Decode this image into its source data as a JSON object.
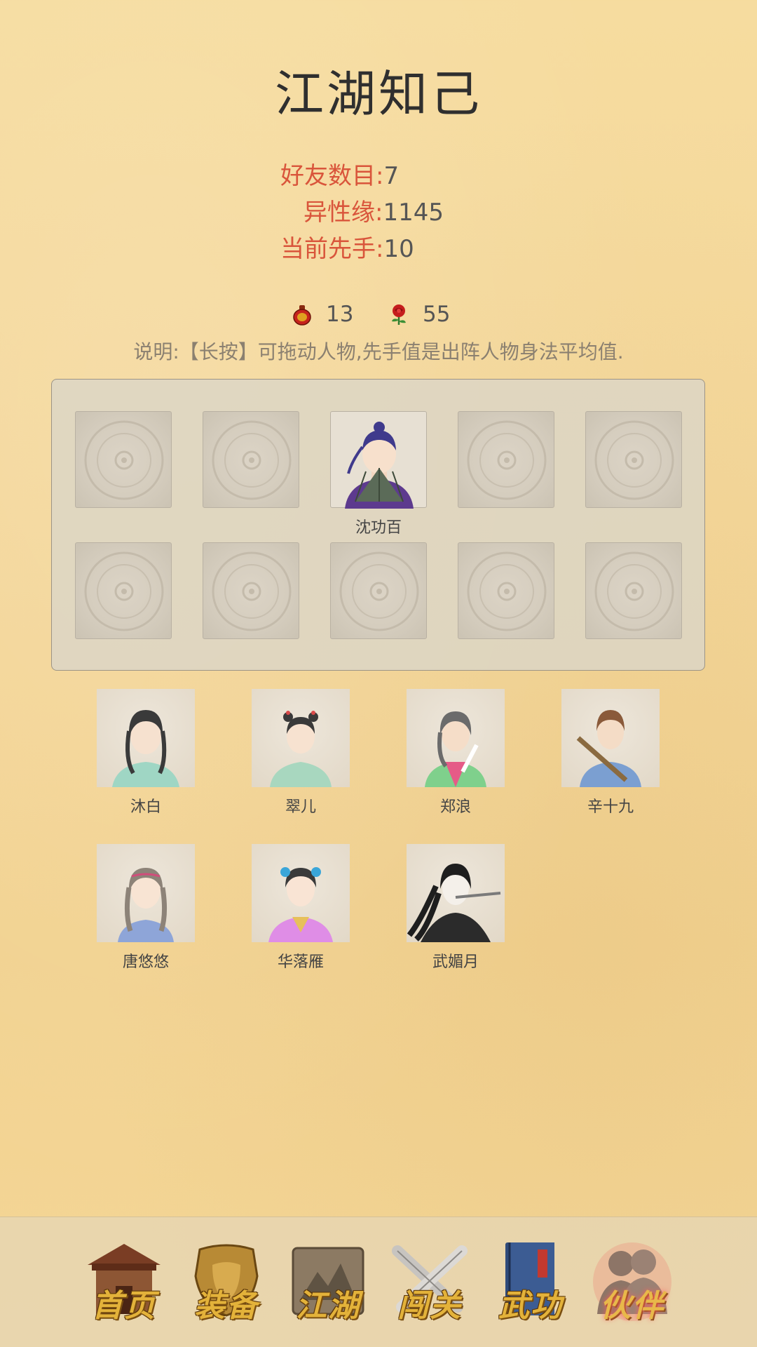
{
  "page": {
    "title": "江湖知己"
  },
  "stats": [
    {
      "label": "好友数目:",
      "value": "7"
    },
    {
      "label": "异性缘:",
      "value": "1145"
    },
    {
      "label": "当前先手:",
      "value": "10"
    }
  ],
  "currency": [
    {
      "icon": "gourd-icon",
      "value": "13"
    },
    {
      "icon": "rose-icon",
      "value": "55"
    }
  ],
  "note": "说明:【长按】可拖动人物,先手值是出阵人物身法平均值.",
  "lineup": {
    "active_character": {
      "name": "沈功百",
      "slot": 3
    }
  },
  "friends": [
    {
      "name": "沐白"
    },
    {
      "name": "翠儿"
    },
    {
      "name": "郑浪"
    },
    {
      "name": "辛十九"
    },
    {
      "name": "唐悠悠"
    },
    {
      "name": "华落雁"
    },
    {
      "name": "武媚月"
    }
  ],
  "nav": {
    "items": [
      {
        "label": "首页",
        "icon": "house-icon"
      },
      {
        "label": "装备",
        "icon": "armor-icon"
      },
      {
        "label": "江湖",
        "icon": "scroll-map-icon"
      },
      {
        "label": "闯关",
        "icon": "crossed-swords-icon"
      },
      {
        "label": "武功",
        "icon": "book-icon"
      },
      {
        "label": "伙伴",
        "icon": "companions-icon",
        "active": true
      }
    ]
  }
}
